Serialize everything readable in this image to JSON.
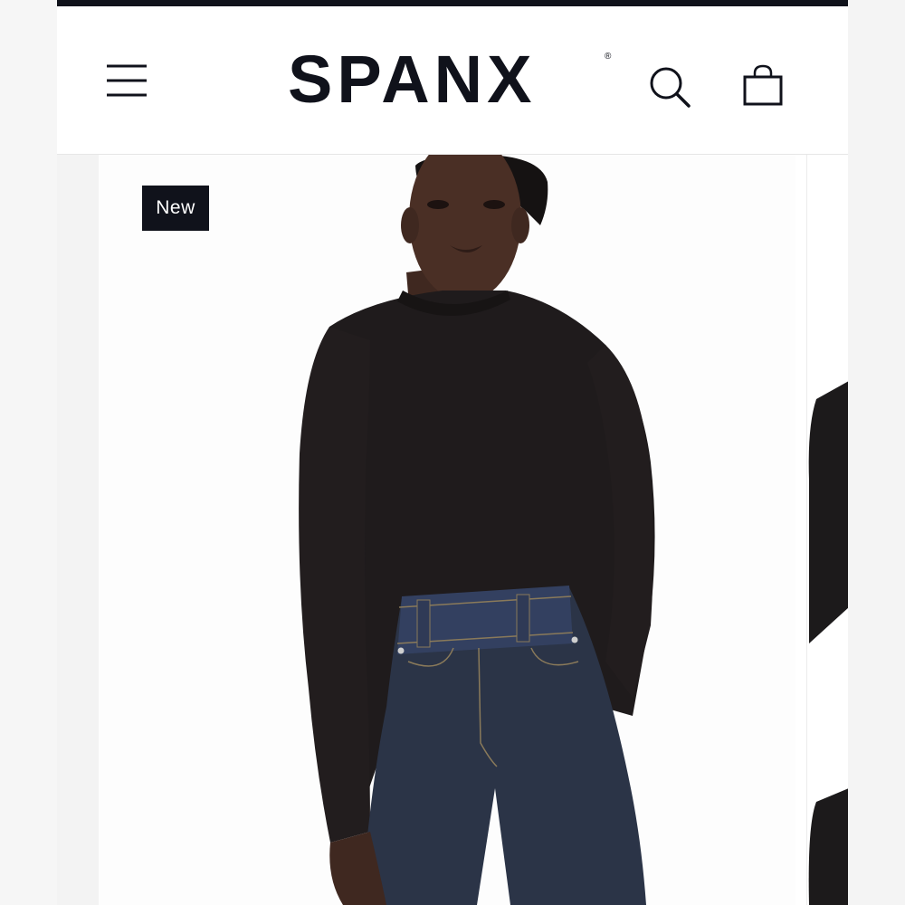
{
  "header": {
    "brand": "SPANX",
    "brand_mark": "®",
    "icons": {
      "menu": "hamburger-menu-icon",
      "search": "search-icon",
      "bag": "shopping-bag-icon"
    }
  },
  "product": {
    "badge": "New"
  },
  "colors": {
    "brand_dark": "#10121b",
    "badge_bg": "#10121b",
    "badge_text": "#ffffff",
    "sweater": "#1f1b1c",
    "denim": "#2b3447",
    "skin": "#4a2f25"
  }
}
